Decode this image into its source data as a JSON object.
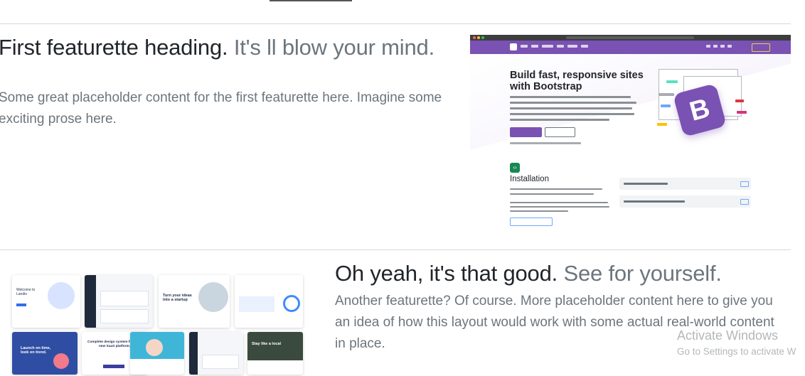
{
  "featurette_1": {
    "heading": "First featurette heading.",
    "heading_muted": "It's ll blow your mind.",
    "lead": "Some great placeholder content for the first featurette here. Imagine some exciting prose here.",
    "image": {
      "hero_title": "Build fast, responsive sites with Bootstrap",
      "logo_letter": "B",
      "section_title": "Installation",
      "brand_color": "#7952b3"
    }
  },
  "featurette_2": {
    "heading": "Oh yeah, it's that good.",
    "heading_muted": "See for yourself.",
    "lead": "Another featurette? Of course. More placeholder content here to give you an idea of how this layout would work with some actual real-world content in place.",
    "image": {
      "card_1_title": "Welcome to Landio",
      "card_3_title": "Turn your ideas into a startup",
      "card_6_title": "Launch on time, look on trend.",
      "card_7_title": "Complete design system for your new SaaS platform.",
      "card_10_title": "Stay like a local"
    }
  },
  "watermark": {
    "title": "Activate Windows",
    "subtitle": "Go to Settings to activate W"
  },
  "colors": {
    "text": "#212529",
    "muted": "#6c757d",
    "divider": "#d6d8db",
    "bootstrap_purple": "#7952b3"
  }
}
